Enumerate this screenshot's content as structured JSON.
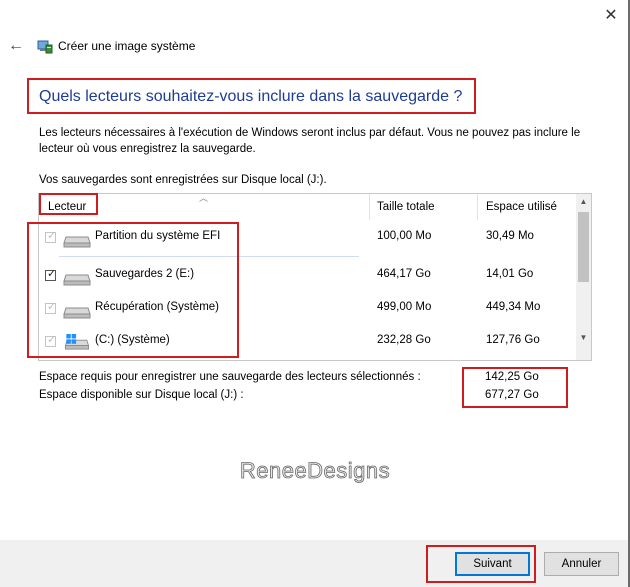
{
  "window": {
    "title": "Créer une image système",
    "close_glyph": "✕",
    "back_glyph": "←"
  },
  "heading": "Quels lecteurs souhaitez-vous inclure dans la sauvegarde ?",
  "description": "Les lecteurs nécessaires à l'exécution de Windows seront inclus par défaut. Vous ne pouvez pas inclure le lecteur où vous enregistrez la sauvegarde.",
  "saved_location": "Vos sauvegardes sont enregistrées sur Disque local (J:).",
  "table": {
    "columns": [
      "Lecteur",
      "Taille totale",
      "Espace utilisé"
    ],
    "rows": [
      {
        "name": "Partition du système EFI",
        "total": "100,00 Mo",
        "used": "30,49 Mo",
        "checked": true,
        "disabled": true,
        "icon": "drive-icon"
      },
      {
        "name": "Sauvegardes 2 (E:)",
        "total": "464,17 Go",
        "used": "14,01 Go",
        "checked": true,
        "disabled": false,
        "icon": "drive-icon"
      },
      {
        "name": "Récupération (Système)",
        "total": "499,00 Mo",
        "used": "449,34 Mo",
        "checked": true,
        "disabled": true,
        "icon": "drive-icon"
      },
      {
        "name": "(C:) (Système)",
        "total": "232,28 Go",
        "used": "127,76 Go",
        "checked": true,
        "disabled": true,
        "icon": "windows-drive-icon"
      }
    ]
  },
  "space": {
    "required_label": "Espace requis pour enregistrer une sauvegarde des lecteurs sélectionnés :",
    "required_value": "142,25 Go",
    "available_label": "Espace disponible sur Disque local (J:) :",
    "available_value": "677,27 Go"
  },
  "watermark": "ReneeDesigns",
  "buttons": {
    "next": "Suivant",
    "cancel": "Annuler"
  },
  "colors": {
    "heading": "#1e3c96",
    "highlight_box": "#d01c1c",
    "primary_button_border": "#0078d7"
  }
}
